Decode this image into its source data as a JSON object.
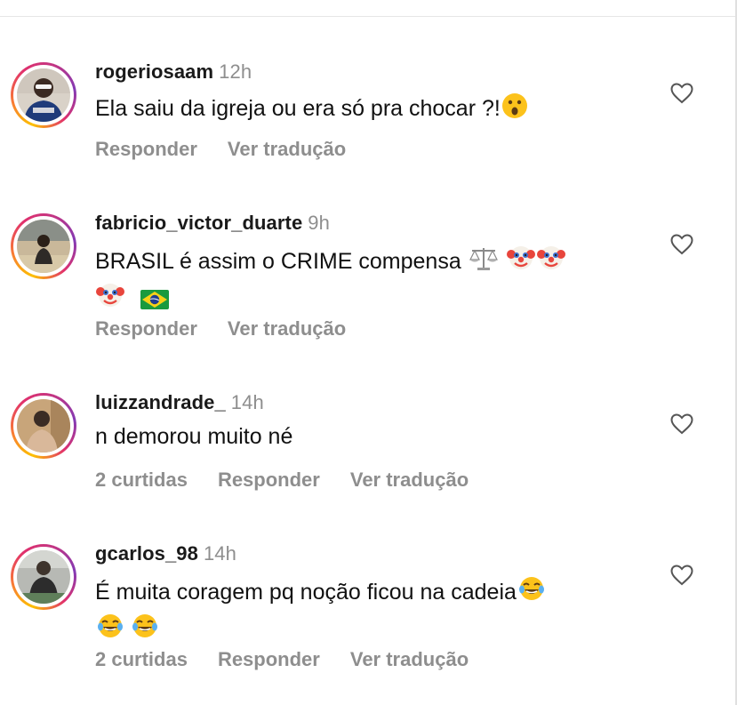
{
  "comments": [
    {
      "username": "rogeriosaam",
      "time": "12h",
      "text_parts": [
        "Ela saiu da igreja ou era só pra chocar ?!"
      ],
      "emojis": [
        "astonished-face"
      ],
      "likes": "",
      "reply_label": "Responder",
      "translate_label": "Ver tradução"
    },
    {
      "username": "fabricio_victor_duarte",
      "time": "9h",
      "text_parts": [
        "BRASIL é assim o CRIME compensa"
      ],
      "emojis": [
        "balance-scale",
        "clown-face",
        "clown-face",
        "clown-face",
        "brazil-flag"
      ],
      "likes": "",
      "reply_label": "Responder",
      "translate_label": "Ver tradução"
    },
    {
      "username": "luizzandrade_",
      "time": "14h",
      "text_parts": [
        "n demorou muito né"
      ],
      "emojis": [],
      "likes": "2 curtidas",
      "reply_label": "Responder",
      "translate_label": "Ver tradução"
    },
    {
      "username": "gcarlos_98",
      "time": "14h",
      "text_parts": [
        "É muita coragem pq noção ficou na cadeia"
      ],
      "emojis": [
        "tears-of-joy",
        "tears-of-joy",
        "tears-of-joy"
      ],
      "likes": "2 curtidas",
      "reply_label": "Responder",
      "translate_label": "Ver tradução"
    }
  ],
  "colors": {
    "username": "#1a1a1a",
    "secondary": "#8e8e8e",
    "ring_start": "#fdc100",
    "ring_mid": "#e1306c",
    "ring_end": "#833ab4"
  }
}
